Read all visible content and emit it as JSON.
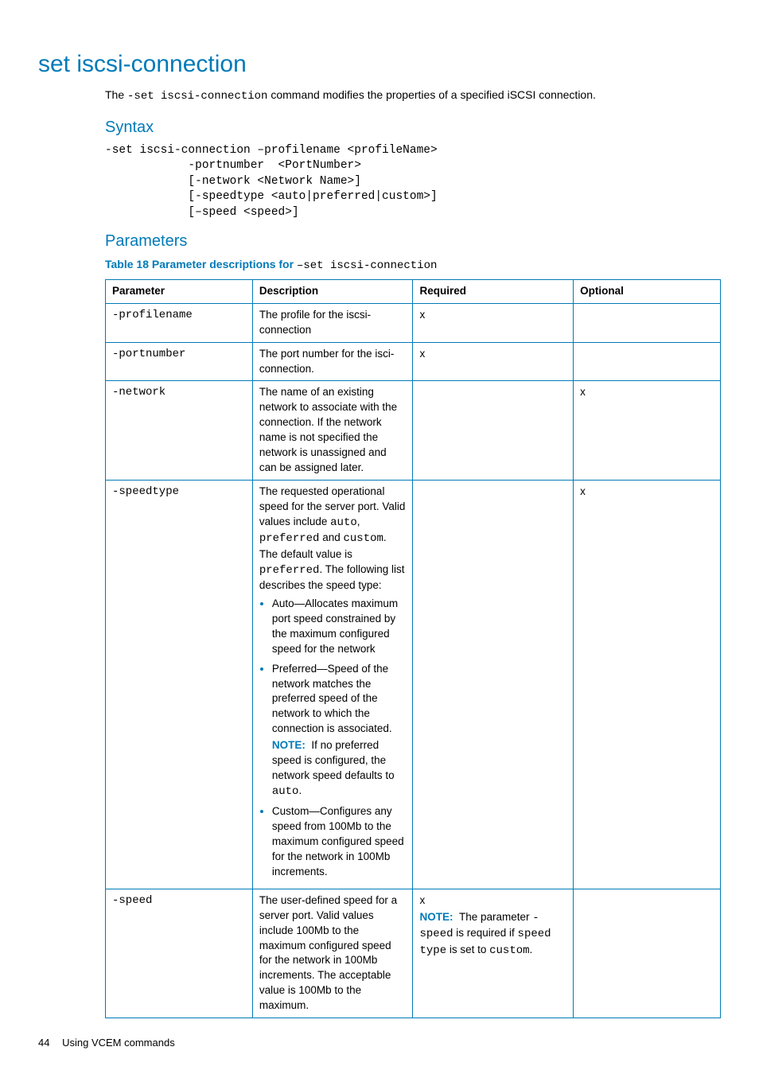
{
  "title": "set iscsi-connection",
  "intro_pre": "The ",
  "intro_cmd": "-set iscsi-connection",
  "intro_post": " command modifies the properties of a specified iSCSI connection.",
  "syntax_heading": "Syntax",
  "syntax_block": "-set iscsi-connection –profilename <profileName>\n            -portnumber  <PortNumber>\n            [-network <Network Name>]\n            [-speedtype <auto|preferred|custom>]\n            [–speed <speed>]",
  "parameters_heading": "Parameters",
  "table_caption_prefix": "Table 18 Parameter descriptions for ",
  "table_caption_cmd": "–set iscsi-connection",
  "table": {
    "headers": {
      "parameter": "Parameter",
      "description": "Description",
      "required": "Required",
      "optional": "Optional"
    },
    "rows": [
      {
        "parameter": "-profilename",
        "description": "The profile for the iscsi-connection",
        "required": "x",
        "optional": ""
      },
      {
        "parameter": "-portnumber",
        "description": "The port number for the isci-connection.",
        "required": "x",
        "optional": ""
      },
      {
        "parameter": "-network",
        "description": "The name of an existing network to associate with the connection. If the network name is not specified the network is unassigned and can be assigned later.",
        "required": "",
        "optional": "x"
      },
      {
        "parameter": "-speedtype",
        "desc_lead_1": "The requested operational speed for the server port. Valid values include ",
        "desc_code_1": "auto",
        "desc_mid_1": ", ",
        "desc_code_2": "preferred",
        "desc_mid_2": " and ",
        "desc_code_3": "custom",
        "desc_mid_3": ". The default value is ",
        "desc_code_4": "preferred",
        "desc_tail_1": ". The following list describes the speed type:",
        "bullet_auto": "Auto—Allocates maximum port speed constrained by the maximum configured speed for the network",
        "bullet_pref": "Preferred—Speed of the network matches the preferred speed of the network to which the connection is associated.",
        "note_label": "NOTE:",
        "note_pref_1": "If no preferred speed is configured, the network speed defaults to ",
        "note_pref_code": "auto",
        "note_pref_2": ".",
        "bullet_custom": "Custom—Configures any speed from 100Mb to the maximum configured speed for the network in 100Mb increments.",
        "required": "",
        "optional": "x"
      },
      {
        "parameter": "-speed",
        "description": "The user-defined speed for a server port. Valid values include 100Mb to the maximum configured speed for the network in 100Mb increments. The acceptable value is 100Mb to the maximum.",
        "required_x": "x",
        "note_label": "NOTE:",
        "note_text_1": "The parameter ",
        "note_code_1": "-speed",
        "note_text_2": " is required if ",
        "note_code_2": "speed type",
        "note_text_3": " is set to ",
        "note_code_3": "custom",
        "note_text_4": ".",
        "optional": ""
      }
    ]
  },
  "footer": {
    "page": "44",
    "label": "Using VCEM commands"
  }
}
